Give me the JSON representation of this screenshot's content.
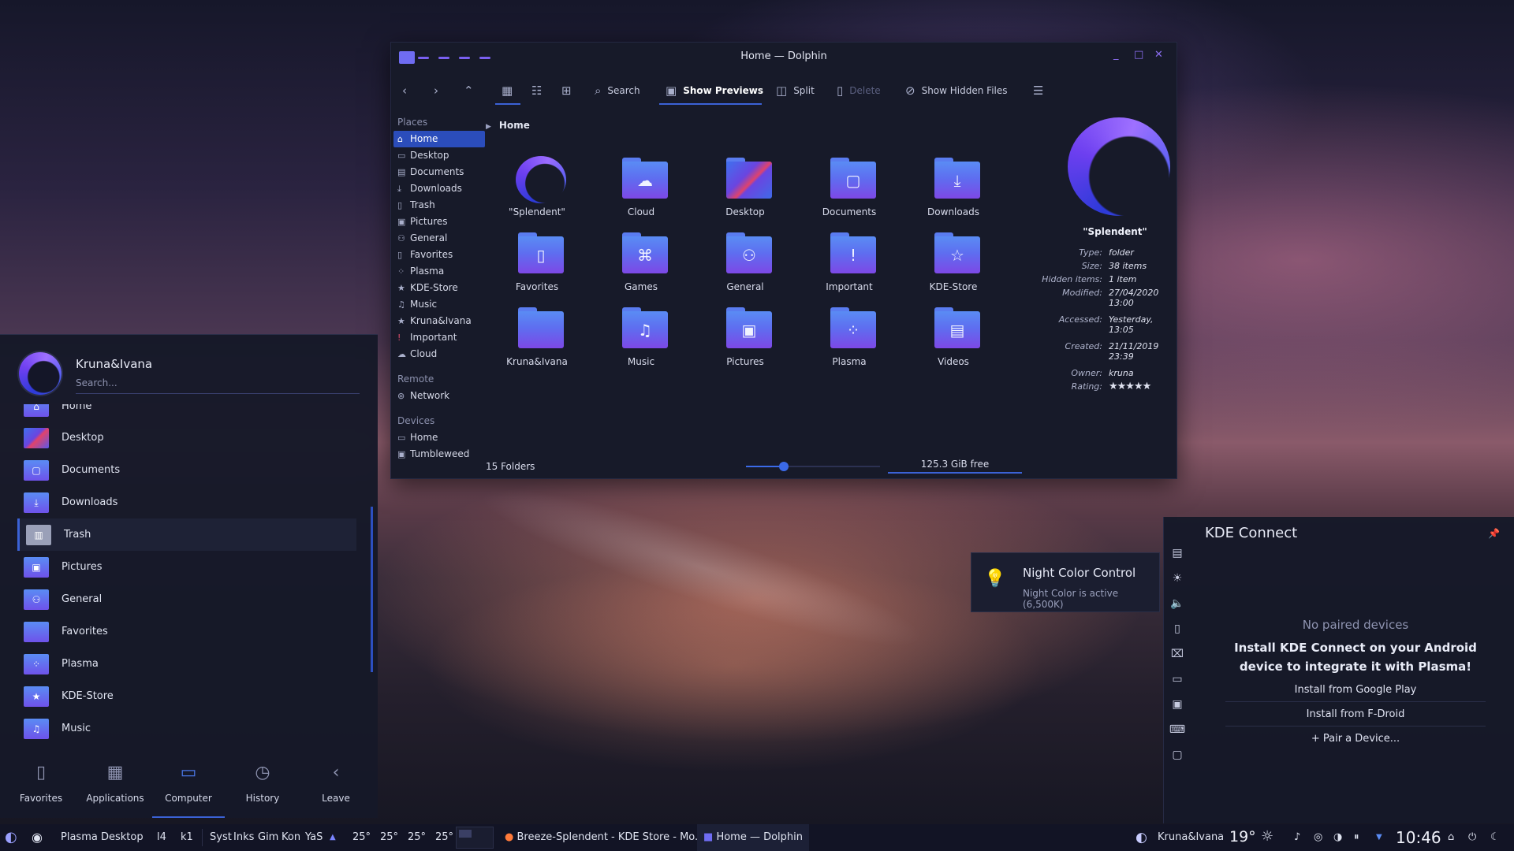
{
  "dolphin": {
    "title": "Home — Dolphin",
    "toolbar": {
      "search": "Search",
      "show_previews": "Show Previews",
      "split": "Split",
      "delete": "Delete",
      "show_hidden": "Show Hidden Files"
    },
    "places": {
      "places_header": "Places",
      "items": [
        "Home",
        "Desktop",
        "Documents",
        "Downloads",
        "Trash",
        "Pictures",
        "General",
        "Favorites",
        "Plasma",
        "KDE-Store",
        "Music",
        "Kruna&Ivana",
        "Important",
        "Cloud"
      ],
      "remote_header": "Remote",
      "remote_items": [
        "Network"
      ],
      "devices_header": "Devices",
      "device_items": [
        "Home",
        "Tumbleweed"
      ]
    },
    "breadcrumb": "Home",
    "folders": [
      "\"Splendent\"",
      "Cloud",
      "Desktop",
      "Documents",
      "Downloads",
      "Favorites",
      "Games",
      "General",
      "Important",
      "KDE-Store",
      "Kruna&Ivana",
      "Music",
      "Pictures",
      "Plasma",
      "Videos"
    ],
    "status": {
      "count": "15 Folders",
      "free": "125.3 GiB free",
      "zoom_fraction": 0.28
    },
    "info": {
      "name": "\"Splendent\"",
      "rows": [
        {
          "k": "Type:",
          "v": "folder"
        },
        {
          "k": "Size:",
          "v": "38 items"
        },
        {
          "k": "Hidden items:",
          "v": "1 item"
        },
        {
          "k": "Modified:",
          "v": "27/04/2020 13:00"
        },
        {
          "k": "Accessed:",
          "v": "Yesterday, 13:05"
        },
        {
          "k": "Created:",
          "v": "21/11/2019 23:39"
        },
        {
          "k": "Owner:",
          "v": "kruna"
        },
        {
          "k": "Rating:",
          "v": ""
        }
      ],
      "rating": 5
    }
  },
  "launcher": {
    "user": "Kruna&Ivana",
    "search_placeholder": "Search...",
    "items": [
      "Home",
      "Desktop",
      "Documents",
      "Downloads",
      "Trash",
      "Pictures",
      "General",
      "Favorites",
      "Plasma",
      "KDE-Store",
      "Music"
    ],
    "tabs": [
      "Favorites",
      "Applications",
      "Computer",
      "History",
      "Leave"
    ]
  },
  "night_color": {
    "title": "Night Color Control",
    "status": "Night Color is active (6,500K)"
  },
  "kde_connect": {
    "title": "KDE Connect",
    "no_devices": "No paired devices",
    "install_msg": "Install KDE Connect on your Android device to integrate it with Plasma!",
    "google_play": "Install from Google Play",
    "fdroid": "Install from F-Droid",
    "pair": "+ Pair a Device..."
  },
  "taskbar": {
    "plasma_desktop": "Plasma Desktop",
    "l4": "l4",
    "k1": "k1",
    "short_labels": [
      "Syst",
      "Inks",
      "Gim",
      "Kon",
      "YaS"
    ],
    "temps": [
      "25°",
      "25°",
      "25°",
      "25°"
    ],
    "task1": "Breeze-Splendent - KDE Store - Mo...",
    "task2": "Home — Dolphin",
    "user": "Kruna&Ivana",
    "weather": "19°",
    "clock": "10:46"
  },
  "colors": {
    "accent": "#3b62d6",
    "folder_top": "#5a8cf4",
    "folder_bottom": "#7d48e6",
    "panel_bg": "#171a29"
  }
}
